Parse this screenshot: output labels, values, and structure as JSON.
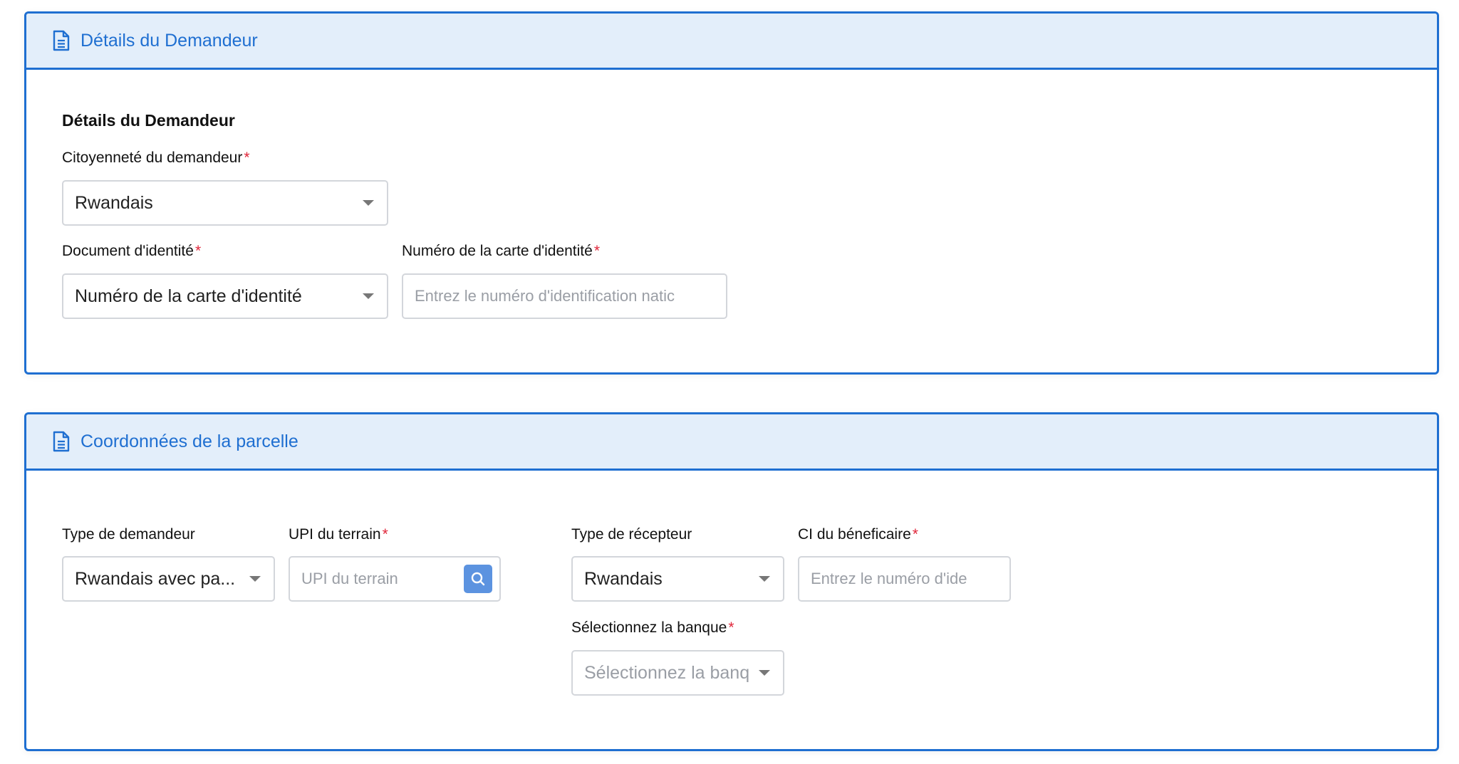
{
  "sections": {
    "applicant": {
      "header_title": "Détails du Demandeur",
      "subtitle": "Détails du Demandeur",
      "citizenship_label": "Citoyenneté du demandeur",
      "citizenship_value": "Rwandais",
      "id_doc_label": "Document d'identité",
      "id_doc_value": "Numéro de la carte d'identité",
      "id_number_label": "Numéro de la carte d'identité",
      "id_number_placeholder": "Entrez le numéro d'identification natic"
    },
    "parcel": {
      "header_title": "Coordonnées de la parcelle",
      "applicant_type_label": "Type de demandeur",
      "applicant_type_value": "Rwandais avec pa...",
      "upi_label": "UPI du terrain",
      "upi_placeholder": "UPI du terrain",
      "receiver_type_label": "Type de récepteur",
      "receiver_type_value": "Rwandais",
      "beneficiary_id_label": "CI du béneficaire",
      "beneficiary_id_placeholder": "Entrez le numéro d'ide",
      "bank_label": "Sélectionnez la banque",
      "bank_placeholder": "Sélectionnez la banq"
    }
  },
  "required_marker": "*",
  "colors": {
    "accent": "#1f6fd1",
    "header_bg": "#e3eefa",
    "required": "#e0263a",
    "search_button": "#5c93e0"
  },
  "icons": {
    "section_header": "document-icon",
    "search": "search-icon",
    "dropdown": "caret-down-icon"
  }
}
